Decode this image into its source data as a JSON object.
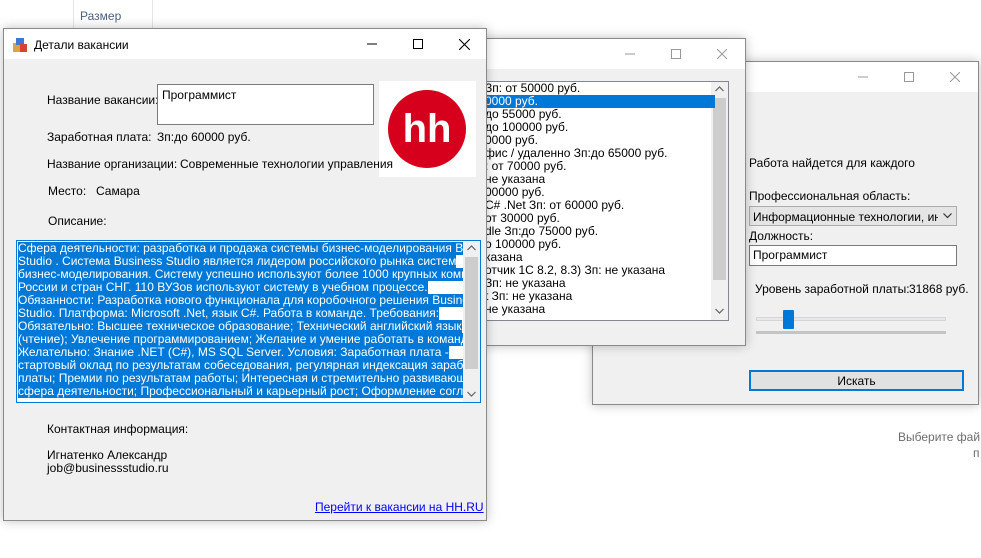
{
  "explorer": {
    "column_header": "Размер",
    "hint_line1": "Выберите фай",
    "hint_line2": "п"
  },
  "search_window": {
    "tagline": "Работа найдется для каждого",
    "area_label": "Профессиональная область:",
    "area_value": "Информационные технологии, интер",
    "position_label": "Должность:",
    "position_value": "Программист",
    "salary_label": "Уровень заработной платы:",
    "salary_value": "31868 руб.",
    "salary_slider_fraction": 0.15,
    "search_button": "Искать"
  },
  "results_window": {
    "items": [
      "Зп: от 50000 руб.",
      "0000 руб.",
      "до 55000 руб.",
      "до 100000 руб.",
      "0000 руб.",
      "фис / удаленно Зп:до 65000 руб.",
      ": от 70000 руб.",
      "не указана",
      "00000 руб.",
      "C# .Net Зп: от 60000 руб.",
      "от 30000 руб.",
      "dle Зп:до 75000 руб.",
      "о 100000 руб.",
      "казана",
      "отчик 1С 8.2, 8.3) Зп: не указана",
      "Зп: не указана",
      "t Зп: не указана",
      "не указана"
    ],
    "selected_index": 1
  },
  "details_window": {
    "title": "Детали вакансии",
    "vacancy_label": "Название вакансии:",
    "vacancy_value": "Программист",
    "salary_label": "Заработная плата:",
    "salary_value": "Зп:до 60000 руб.",
    "org_label": "Название организации:",
    "org_value": "Современные технологии управления",
    "place_label": "Место:",
    "place_value": "Самара",
    "description_label": "Описание:",
    "logo_text": "hh",
    "description_lines": [
      "Сфера деятельности: разработка и продажа системы бизнес-моделирования Business",
      "Studio . Система Business Studio является лидером российского рынка систем",
      "бизнес-моделирования. Систему успешно используют более 1000 крупных компаний",
      "России и стран СНГ. 110 ВУЗов используют систему в учебном процессе.",
      "Обязанности:  Разработка нового функционала для коробочного решения Business",
      "Studio. Платформа: Microsoft .Net, язык C#. Работа в команде.   Требования:",
      "Обязательно:  Высшее техническое образование; Технический английский язык",
      "(чтение); Увлечение программированием; Желание и умение работать в команде.",
      "Желательно:  Знание .NET (C#), MS SQL Server.      Условия:  Заработная плата -",
      "стартовый оклад по результатам собеседования, регулярная индексация заработной",
      "платы; Премии по результатам работы; Интересная и стремительно развивающаяся",
      "сфера деятельности; Профессиональный и карьерный рост; Оформление согласно"
    ],
    "contact_label": "Контактная информация:",
    "contact_name": "Игнатенко Александр",
    "contact_email": "job@businessstudio.ru",
    "link_text": "Перейти к вакансии на HH.RU"
  }
}
